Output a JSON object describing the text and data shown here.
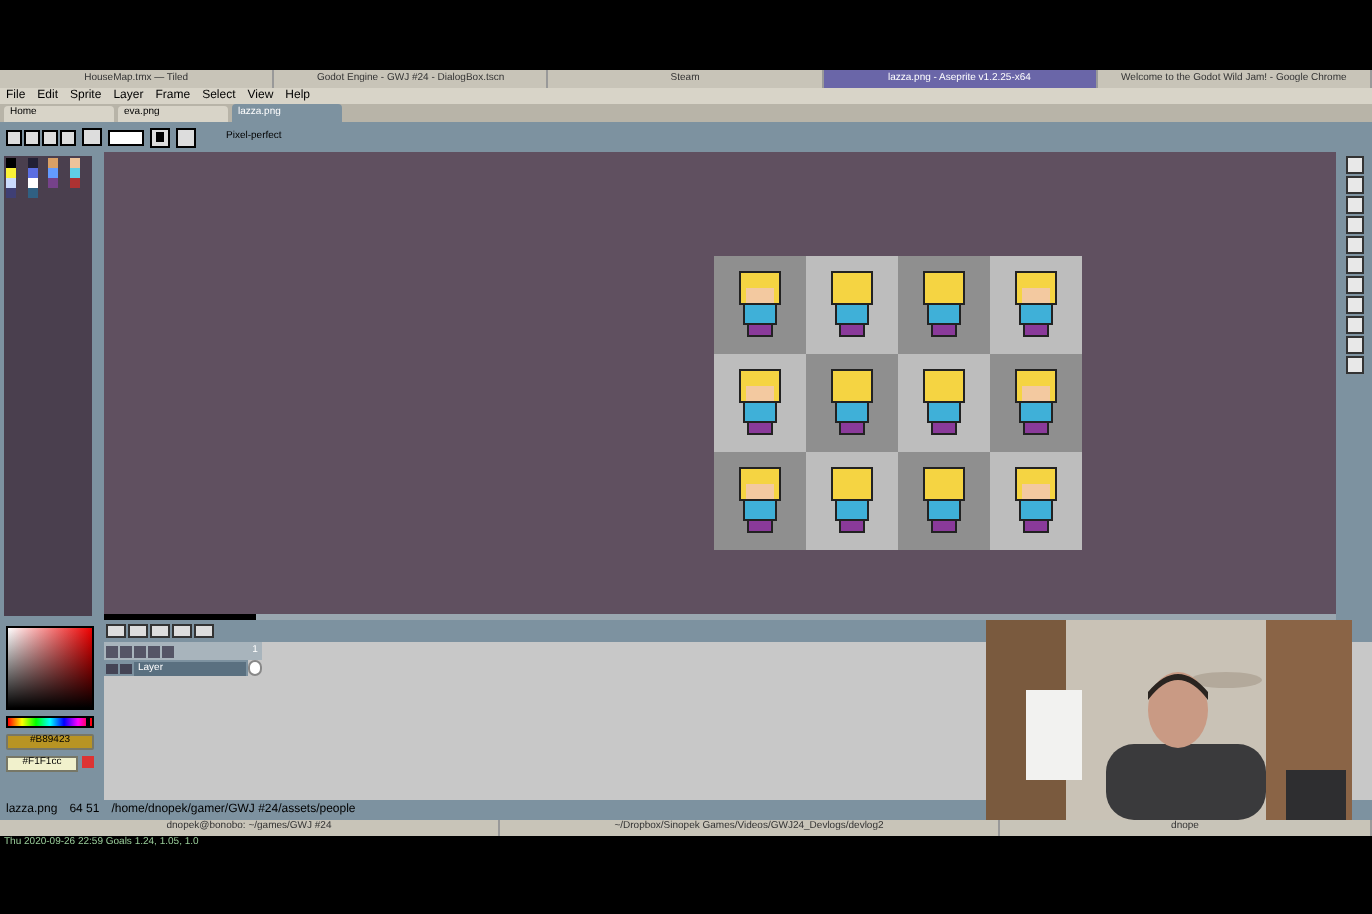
{
  "taskbar": [
    {
      "label": "HouseMap.tmx — Tiled",
      "selected": false
    },
    {
      "label": "Godot Engine - GWJ #24 - DialogBox.tscn",
      "selected": false
    },
    {
      "label": "Steam",
      "selected": false
    },
    {
      "label": "lazza.png - Aseprite v1.2.25-x64",
      "selected": true
    },
    {
      "label": "Welcome to the Godot Wild Jam! - Google Chrome",
      "selected": false
    }
  ],
  "menu": [
    "File",
    "Edit",
    "Sprite",
    "Layer",
    "Frame",
    "Select",
    "View",
    "Help"
  ],
  "tabs": [
    {
      "label": "Home",
      "selected": false
    },
    {
      "label": "eva.png",
      "selected": false
    },
    {
      "label": "lazza.png",
      "selected": true
    }
  ],
  "toolbar": {
    "option": "Pixel-perfect"
  },
  "palette": [
    {
      "color": "#000000"
    },
    {
      "color": "#222034"
    },
    {
      "color": "#d9a066"
    },
    {
      "color": "#eec39a"
    },
    {
      "color": "#fbf236"
    },
    {
      "color": "#5b6ee1"
    },
    {
      "color": "#639bff"
    },
    {
      "color": "#5fcde4"
    },
    {
      "color": "#cbdbfc"
    },
    {
      "color": "#ffffff"
    },
    {
      "color": "#76428a"
    },
    {
      "color": "#ac3232"
    },
    {
      "color": "#3f3f74"
    },
    {
      "color": "#306082"
    }
  ],
  "colors": {
    "foreground": "#B89423",
    "background": "#F1F1cc"
  },
  "hue_slider": {
    "level": 0.97
  },
  "timeline": {
    "frame": "1",
    "layers": [
      {
        "name": "Layer",
        "selected": true
      }
    ]
  },
  "status_bar": {
    "file": "lazza.png",
    "size": "64 51",
    "path": "/home/dnopek/gamer/GWJ #24/assets/people"
  },
  "terminals": [
    "dnopek@bonobo: ~/games/GWJ #24",
    "~/Dropbox/Sinopek Games/Videos/GWJ24_Devlogs/devlog2",
    "dnope"
  ],
  "system_line": "Thu 2020-09-26 22:59  Goals 1.24, 1.05, 1.0"
}
